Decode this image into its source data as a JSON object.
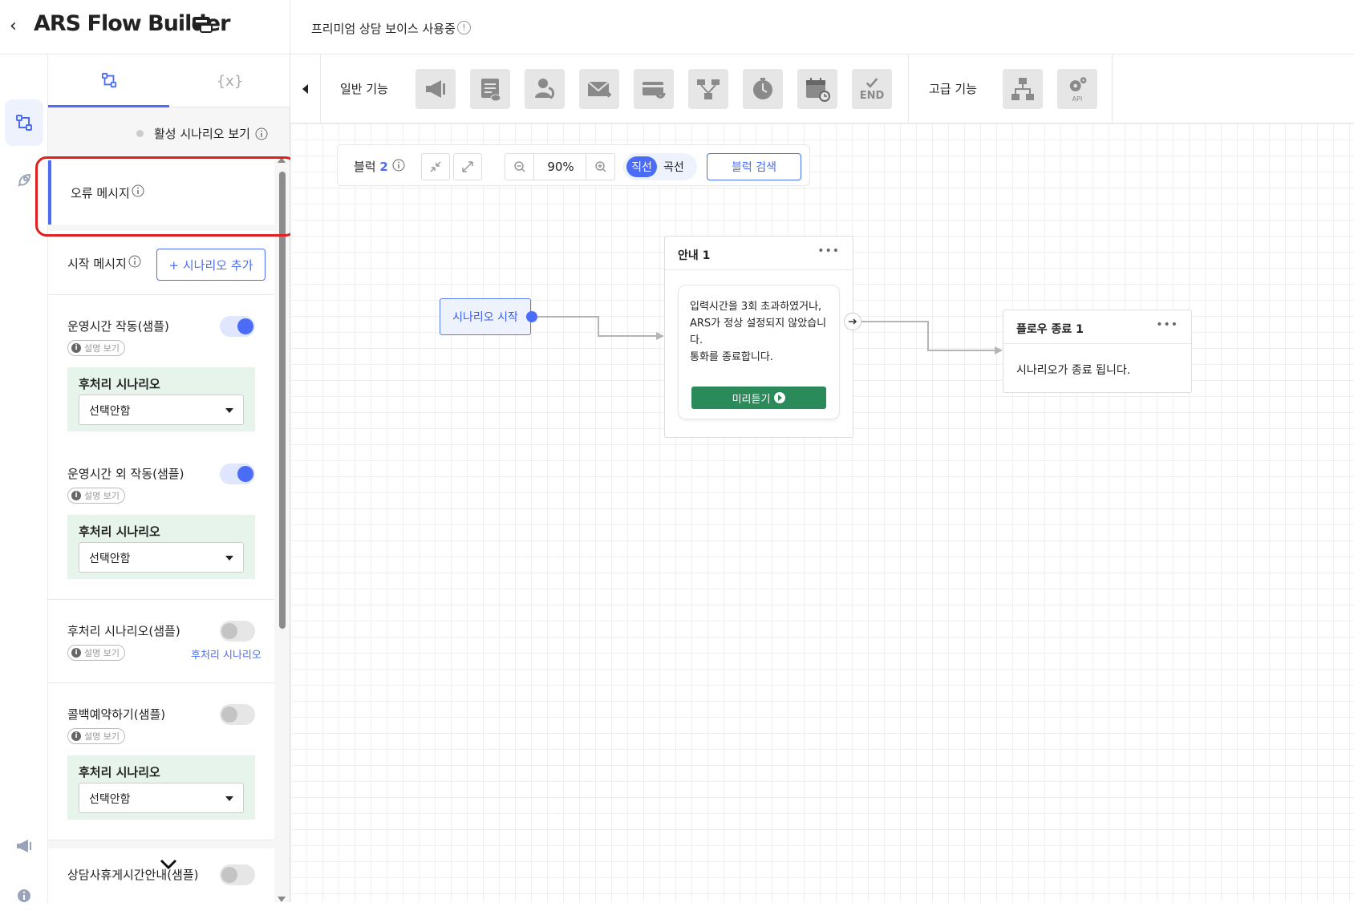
{
  "header": {
    "app_title": "ARS Flow Builder",
    "plan_status": "프리미엄 상담 보이스 사용중",
    "info_symbol": "!"
  },
  "panel": {
    "vars_tab_label": "{x}",
    "active_scenario_label": "활성 시나리오 보기",
    "error_message_label": "오류 메시지",
    "start_message_label": "시작 메시지",
    "add_scenario_label": "+ 시나리오 추가",
    "desc_label": "설명 보기",
    "post_scenario_label": "후처리 시나리오",
    "scenarios": [
      {
        "title": "운영시간 작동(샘플)",
        "enabled": true,
        "select_value": "선택안함"
      },
      {
        "title": "운영시간 외 작동(샘플)",
        "enabled": true,
        "select_value": "선택안함"
      },
      {
        "title": "후처리 시나리오(샘플)",
        "enabled": false,
        "link": "후처리 시나리오"
      },
      {
        "title": "콜백예약하기(샘플)",
        "enabled": false,
        "select_value": "선택안함"
      },
      {
        "title": "상담사휴게시간안내(샘플)",
        "enabled": false
      }
    ]
  },
  "toolbar": {
    "basic_label": "일반 기능",
    "advanced_label": "고급 기능",
    "end_tool_label": "END",
    "api_tool_label": "API",
    "basic_tools": [
      "megaphone-icon",
      "message-icon",
      "agent-icon",
      "mail-icon",
      "card-icon",
      "branch-icon",
      "clock-icon",
      "calendar-icon",
      "end-icon"
    ],
    "advanced_tools": [
      "org-chart-icon",
      "api-gear-icon"
    ]
  },
  "canvas": {
    "block_label": "블럭",
    "block_count": "2",
    "zoom": "90%",
    "line_straight": "직선",
    "line_curve": "곡선",
    "block_search": "블럭 검색",
    "start_node": "시나리오 시작",
    "guide_node": {
      "title": "안내 1",
      "message": "입력시간을 3회 초과하였거나, ARS가 정상 설정되지 않았습니다.\n통화를 종료합니다.",
      "preview": "미리듣기",
      "more": "•••"
    },
    "end_node": {
      "title": "플로우 종료 1",
      "message": "시나리오가 종료 됩니다.",
      "more": "•••"
    }
  },
  "colors": {
    "accent": "#4a6cf7",
    "preview_green": "#2a8a5a",
    "post_box_bg": "#e7f4ec",
    "highlight": "#e02020"
  }
}
